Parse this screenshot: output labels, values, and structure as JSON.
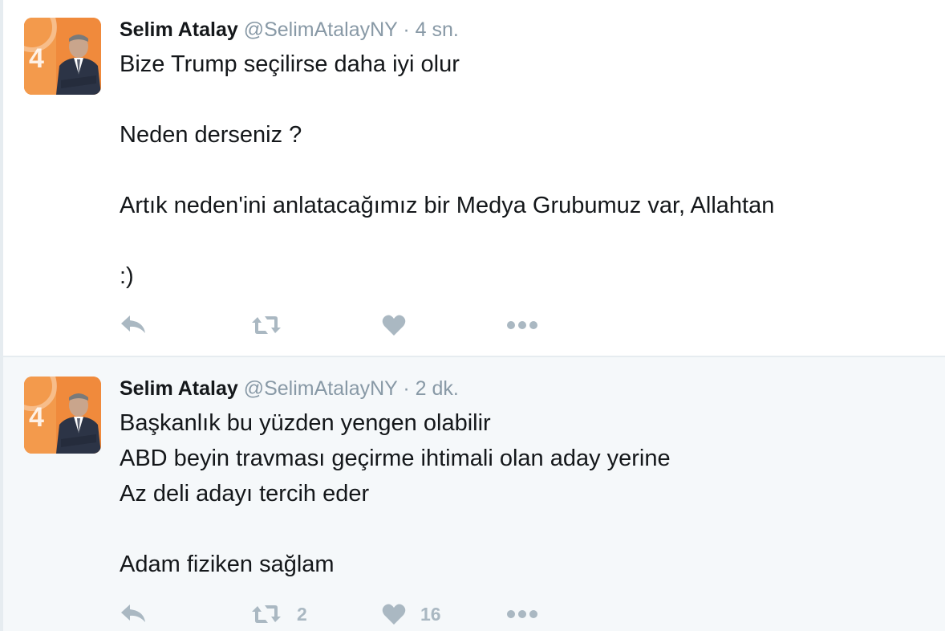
{
  "tweets": [
    {
      "author": {
        "fullname": "Selim Atalay",
        "handle": "@SelimAtalayNY",
        "avatar_label": "avatar"
      },
      "separator": "·",
      "time": "4 sn.",
      "text_lines": [
        "Bize Trump seçilirse daha iyi olur",
        "",
        "Neden derseniz ?",
        "",
        "Artık neden'ini anlatacağımız bir Medya Grubumuz var, Allahtan",
        "",
        ":)"
      ],
      "actions": {
        "reply_icon": "reply-icon",
        "retweet_icon": "retweet-icon",
        "retweet_count": "",
        "like_icon": "heart-icon",
        "like_count": "",
        "more_icon": "more-dots-icon"
      }
    },
    {
      "author": {
        "fullname": "Selim Atalay",
        "handle": "@SelimAtalayNY",
        "avatar_label": "avatar"
      },
      "separator": "·",
      "time": "2 dk.",
      "text_lines": [
        "Başkanlık bu yüzden yengen olabilir",
        "ABD beyin travması geçirme ihtimali olan aday yerine",
        "Az deli adayı tercih eder",
        "",
        "Adam fiziken sağlam"
      ],
      "actions": {
        "reply_icon": "reply-icon",
        "retweet_icon": "retweet-icon",
        "retweet_count": "2",
        "like_icon": "heart-icon",
        "like_count": "16",
        "more_icon": "more-dots-icon"
      }
    }
  ],
  "colors": {
    "text_primary": "#14171a",
    "text_secondary": "#8899a6",
    "action_icon": "#aab8c2",
    "highlight_background": "#f5f8fa",
    "border": "#e6ecf0",
    "avatar_orange": "#f08a3c"
  }
}
